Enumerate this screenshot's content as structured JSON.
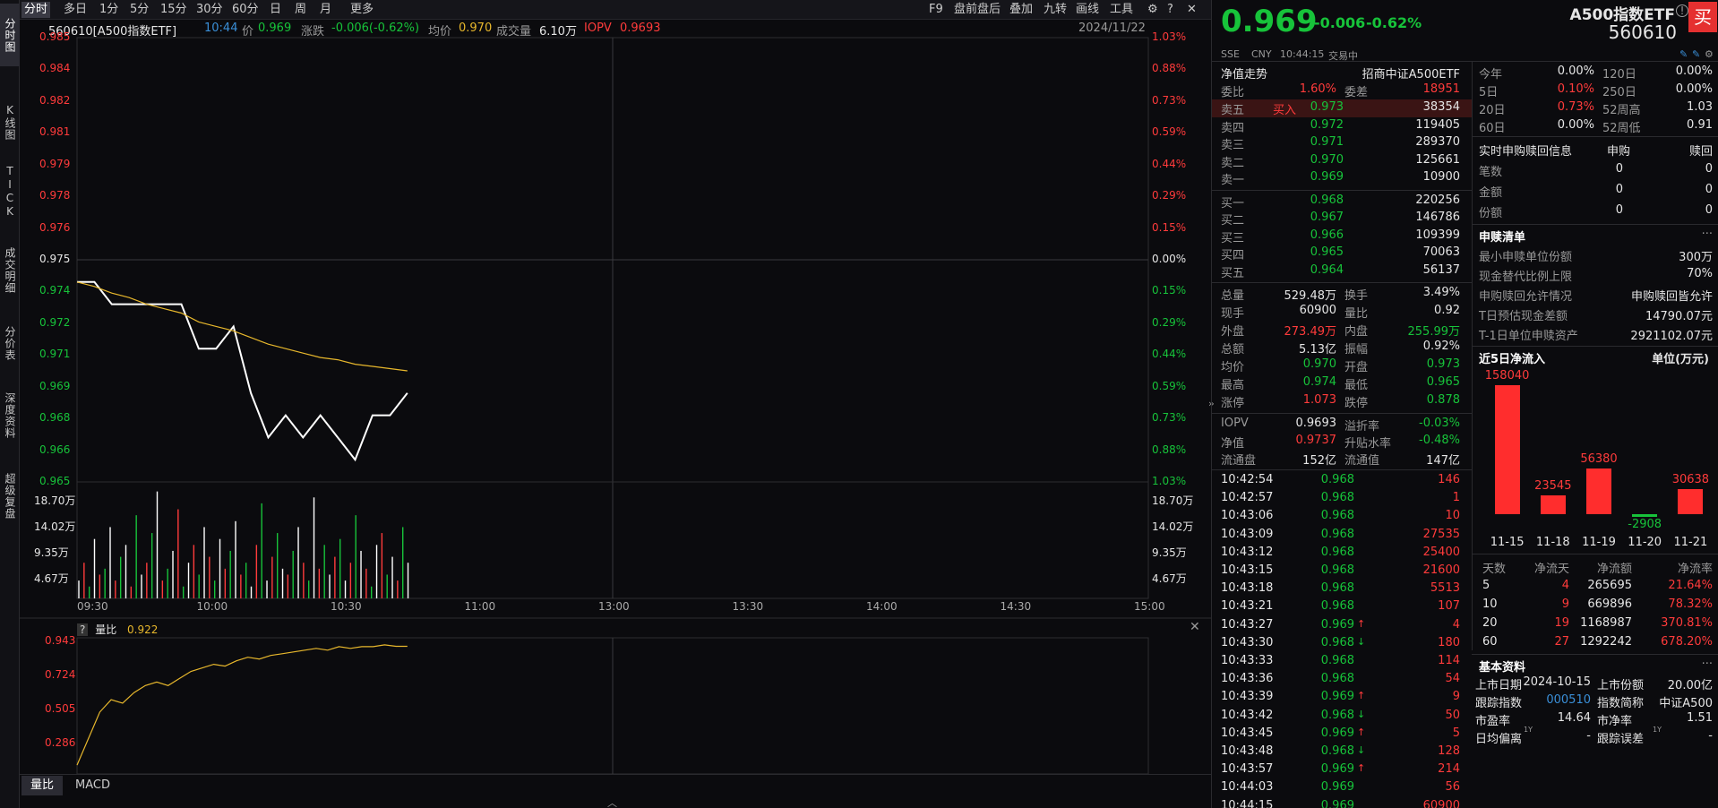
{
  "left_tabs": [
    "分时图",
    "K线图",
    "TICK",
    "成交明细",
    "分价表",
    "深度资料",
    "超级复盘"
  ],
  "periods": [
    "分时",
    "多日",
    "1分",
    "5分",
    "15分",
    "30分",
    "60分",
    "日",
    "周",
    "月",
    "更多"
  ],
  "toolbar": [
    "F9",
    "盘前盘后",
    "叠加",
    "九转",
    "画线",
    "工具"
  ],
  "info": {
    "name": "560610[A500指数ETF]",
    "time": "10:44",
    "price_label": "价",
    "price": "0.969",
    "change_label": "涨跌",
    "change": "-0.006(-0.62%)",
    "avg_label": "均价",
    "avg": "0.970",
    "vol_label": "成交量",
    "vol": "6.10万",
    "iopv_label": "IOPV",
    "iopv": "0.9693",
    "date": "2024/11/22"
  },
  "price_axis": [
    "0.985",
    "0.984",
    "0.982",
    "0.981",
    "0.979",
    "0.978",
    "0.976",
    "0.975",
    "0.974",
    "0.972",
    "0.971",
    "0.969",
    "0.968",
    "0.966",
    "0.965"
  ],
  "pct_axis": [
    "1.03%",
    "0.88%",
    "0.73%",
    "0.59%",
    "0.44%",
    "0.29%",
    "0.15%",
    "0.00%",
    "0.15%",
    "0.29%",
    "0.44%",
    "0.59%",
    "0.73%",
    "0.88%",
    "1.03%"
  ],
  "vol_axis": [
    "18.70万",
    "14.02万",
    "9.35万",
    "4.67万"
  ],
  "time_axis": [
    "09:30",
    "10:00",
    "10:30",
    "11:00",
    "13:00",
    "13:30",
    "14:00",
    "14:30",
    "15:00"
  ],
  "sub": {
    "q": "?",
    "label": "量比",
    "value": "0.922",
    "axis": [
      "0.943",
      "0.724",
      "0.505",
      "0.286"
    ]
  },
  "bottom_tabs": [
    "量比",
    "MACD"
  ],
  "header": {
    "price": "0.969",
    "change": "-0.006",
    "pct": "-0.62%",
    "name": "A500指数ETF",
    "code": "560610",
    "market": "SSE",
    "currency": "CNY",
    "time": "10:44:15",
    "status": "交易中",
    "buy_btn": "买",
    "nav_label": "净值走势",
    "index_name": "招商中证A500ETF"
  },
  "weibi": {
    "l1": "委比",
    "v1": "1.60%",
    "l2": "委差",
    "v2": "18951"
  },
  "asks": [
    [
      "卖五",
      "买入",
      "0.973",
      "38354"
    ],
    [
      "卖四",
      "",
      "0.972",
      "119405"
    ],
    [
      "卖三",
      "",
      "0.971",
      "289370"
    ],
    [
      "卖二",
      "",
      "0.970",
      "125661"
    ],
    [
      "卖一",
      "",
      "0.969",
      "10900"
    ]
  ],
  "bids": [
    [
      "买一",
      "0.968",
      "220256"
    ],
    [
      "买二",
      "0.967",
      "146786"
    ],
    [
      "买三",
      "0.966",
      "109399"
    ],
    [
      "买四",
      "0.965",
      "70063"
    ],
    [
      "买五",
      "0.964",
      "56137"
    ]
  ],
  "stats": [
    [
      "总量",
      "529.48万",
      "换手",
      "3.49%"
    ],
    [
      "现手",
      "60900",
      "量比",
      "0.92"
    ],
    [
      "外盘",
      "273.49万",
      "内盘",
      "255.99万"
    ],
    [
      "总额",
      "5.13亿",
      "振幅",
      "0.92%"
    ],
    [
      "均价",
      "0.970",
      "开盘",
      "0.973"
    ],
    [
      "最高",
      "0.974",
      "最低",
      "0.965"
    ],
    [
      "涨停",
      "1.073",
      "跌停",
      "0.878"
    ]
  ],
  "iopv_stats": [
    [
      "IOPV",
      "0.9693",
      "溢折率",
      "-0.03%"
    ],
    [
      "净值",
      "0.9737",
      "升贴水率",
      "-0.48%"
    ],
    [
      "流通盘",
      "152亿",
      "流通值",
      "147亿"
    ]
  ],
  "ticks": [
    [
      "10:42:54",
      "0.968",
      "146",
      ""
    ],
    [
      "10:42:57",
      "0.968",
      "1",
      ""
    ],
    [
      "10:43:06",
      "0.968",
      "10",
      ""
    ],
    [
      "10:43:09",
      "0.968",
      "27535",
      ""
    ],
    [
      "10:43:12",
      "0.968",
      "25400",
      ""
    ],
    [
      "10:43:15",
      "0.968",
      "21600",
      ""
    ],
    [
      "10:43:18",
      "0.968",
      "5513",
      ""
    ],
    [
      "10:43:21",
      "0.968",
      "107",
      ""
    ],
    [
      "10:43:27",
      "0.969",
      "4",
      "up"
    ],
    [
      "10:43:30",
      "0.968",
      "180",
      "down"
    ],
    [
      "10:43:33",
      "0.968",
      "114",
      ""
    ],
    [
      "10:43:36",
      "0.968",
      "54",
      ""
    ],
    [
      "10:43:39",
      "0.969",
      "9",
      "up"
    ],
    [
      "10:43:42",
      "0.968",
      "50",
      "down"
    ],
    [
      "10:43:45",
      "0.969",
      "5",
      "up"
    ],
    [
      "10:43:48",
      "0.968",
      "128",
      "down"
    ],
    [
      "10:43:57",
      "0.969",
      "214",
      "up"
    ],
    [
      "10:44:03",
      "0.969",
      "56",
      ""
    ],
    [
      "10:44:15",
      "0.969",
      "60900",
      ""
    ]
  ],
  "perf": [
    [
      "今年",
      "0.00%",
      "120日",
      "0.00%"
    ],
    [
      "5日",
      "0.10%",
      "250日",
      "0.00%"
    ],
    [
      "20日",
      "0.73%",
      "52周高",
      "1.03"
    ],
    [
      "60日",
      "0.00%",
      "52周低",
      "0.91"
    ]
  ],
  "redemption": {
    "title": "实时申购赎回信息",
    "col1": "申购",
    "col2": "赎回",
    "rows": [
      [
        "笔数",
        "0",
        "0"
      ],
      [
        "金额",
        "0",
        "0"
      ],
      [
        "份额",
        "0",
        "0"
      ]
    ]
  },
  "creation": {
    "title": "申赎清单",
    "more": "···",
    "rows": [
      [
        "最小申赎单位份额",
        "300万"
      ],
      [
        "现金替代比例上限",
        "70%"
      ],
      [
        "申购赎回允许情况",
        "申购赎回皆允许"
      ],
      [
        "T日预估现金差额",
        "14790.07元"
      ],
      [
        "T-1日单位申赎资产",
        "2921102.07元"
      ]
    ]
  },
  "netflow": {
    "title": "近5日净流入",
    "unit": "单位(万元)",
    "dates": [
      "11-15",
      "11-18",
      "11-19",
      "11-20",
      "11-21"
    ],
    "values": [
      158040,
      23545,
      56380,
      -2908,
      30638
    ],
    "labels": [
      "158040",
      "23545",
      "56380",
      "-2908",
      "30638"
    ]
  },
  "flow_table": {
    "headers": [
      "天数",
      "净流天",
      "净流额",
      "净流率"
    ],
    "rows": [
      [
        "5",
        "4",
        "265695",
        "21.64%"
      ],
      [
        "10",
        "9",
        "669896",
        "78.32%"
      ],
      [
        "20",
        "19",
        "1168987",
        "370.81%"
      ],
      [
        "60",
        "27",
        "1292242",
        "678.20%"
      ]
    ]
  },
  "basics": {
    "title": "基本资料",
    "more": "···",
    "rows": [
      [
        "上市日期",
        "2024-10-15",
        "上市份额",
        "20.00亿"
      ],
      [
        "跟踪指数",
        "000510",
        "指数简称",
        "中证A500"
      ],
      [
        "市盈率",
        "14.64",
        "市净率",
        "1.51"
      ],
      [
        "日均偏离",
        "-",
        "跟踪误差",
        "-"
      ]
    ],
    "sup": "1Y"
  },
  "colors": {
    "up": "#ff3b3b",
    "down": "#17c33a",
    "price_line": "#ffffff",
    "avg_line": "#e7b72c"
  },
  "chart_data": {
    "type": "line",
    "x": [
      "09:30",
      "09:34",
      "09:38",
      "09:42",
      "09:46",
      "09:50",
      "09:54",
      "09:58",
      "10:02",
      "10:06",
      "10:10",
      "10:14",
      "10:18",
      "10:22",
      "10:26",
      "10:30",
      "10:34",
      "10:38",
      "10:42",
      "10:44"
    ],
    "series": [
      {
        "values": [
          0.974,
          0.974,
          0.973,
          0.973,
          0.973,
          0.973,
          0.973,
          0.971,
          0.971,
          0.972,
          0.969,
          0.967,
          0.968,
          0.967,
          0.968,
          0.967,
          0.966,
          0.968,
          0.968,
          0.969
        ]
      },
      {
        "values": [
          0.974,
          0.9738,
          0.9735,
          0.9733,
          0.973,
          0.9728,
          0.9726,
          0.9722,
          0.972,
          0.9718,
          0.9715,
          0.9712,
          0.971,
          0.9708,
          0.9706,
          0.9705,
          0.9703,
          0.9702,
          0.9701,
          0.97
        ]
      }
    ],
    "ylim": [
      0.965,
      0.985
    ],
    "volume": [
      3,
      6,
      2,
      10,
      4,
      5,
      12,
      3,
      7,
      9,
      2,
      14,
      4,
      6,
      11,
      18,
      3,
      5,
      8,
      15,
      2,
      6,
      9,
      4,
      12,
      7,
      3,
      10,
      5,
      8,
      13,
      4,
      6,
      2,
      9,
      16,
      3,
      7,
      11,
      5,
      4,
      8,
      12,
      6,
      3,
      17,
      5,
      9,
      4,
      7,
      10,
      3,
      6,
      14,
      8,
      5,
      2,
      9,
      11,
      4,
      7,
      3,
      12,
      6
    ],
    "vol_max": 18.7,
    "volume_ratio": [
      0.25,
      0.4,
      0.55,
      0.62,
      0.6,
      0.66,
      0.7,
      0.72,
      0.7,
      0.74,
      0.78,
      0.8,
      0.82,
      0.81,
      0.84,
      0.86,
      0.85,
      0.87,
      0.88,
      0.89,
      0.9,
      0.91,
      0.9,
      0.92,
      0.91,
      0.92,
      0.92,
      0.93,
      0.922,
      0.922
    ],
    "vr_ylim": [
      0.2,
      0.97
    ]
  }
}
